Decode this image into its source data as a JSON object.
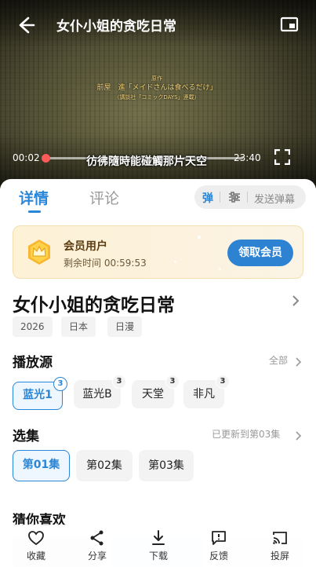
{
  "player": {
    "title": "女仆小姐的贪吃日常",
    "credits_line1": "原作",
    "credits_line2": "前屋　進「メイドさんは食べるだけ」",
    "credits_line3": "（講談社「コミックDAYS」連載）",
    "subtitle": "彷彿隨時能碰觸那片天空",
    "current_time": "00:02",
    "total_time": "23:40",
    "progress": 0.0014
  },
  "tabs": [
    {
      "label": "详情"
    },
    {
      "label": "评论"
    }
  ],
  "danmaku": {
    "toggle_label": "弹",
    "send_label": "发送弹幕"
  },
  "member": {
    "title": "会员用户",
    "remaining": "剩余时间 00:59:53",
    "button": "领取会员"
  },
  "show": {
    "title": "女仆小姐的贪吃日常",
    "tags": [
      "2026",
      "日本",
      "日漫"
    ]
  },
  "sources": {
    "title": "播放源",
    "more": "全部",
    "items": [
      {
        "label": "蓝光1",
        "count": "3",
        "selected": true
      },
      {
        "label": "蓝光B",
        "count": "3",
        "selected": false
      },
      {
        "label": "天堂",
        "count": "3",
        "selected": false
      },
      {
        "label": "非凡",
        "count": "3",
        "selected": false
      }
    ]
  },
  "episodes": {
    "title": "选集",
    "more": "已更新到第03集",
    "items": [
      {
        "label": "第01集",
        "selected": true
      },
      {
        "label": "第02集",
        "selected": false
      },
      {
        "label": "第03集",
        "selected": false
      }
    ]
  },
  "recommend": {
    "title": "猜你喜欢"
  },
  "toolbar": {
    "items": [
      {
        "label": "收藏",
        "icon": "heart-icon"
      },
      {
        "label": "分享",
        "icon": "share-icon"
      },
      {
        "label": "下载",
        "icon": "download-icon"
      },
      {
        "label": "反馈",
        "icon": "feedback-icon"
      },
      {
        "label": "投屏",
        "icon": "cast-icon"
      }
    ]
  },
  "colors": {
    "accent": "#2a86d6",
    "progress": "#ff5a5a",
    "member_bg": "#fdf1d6"
  }
}
